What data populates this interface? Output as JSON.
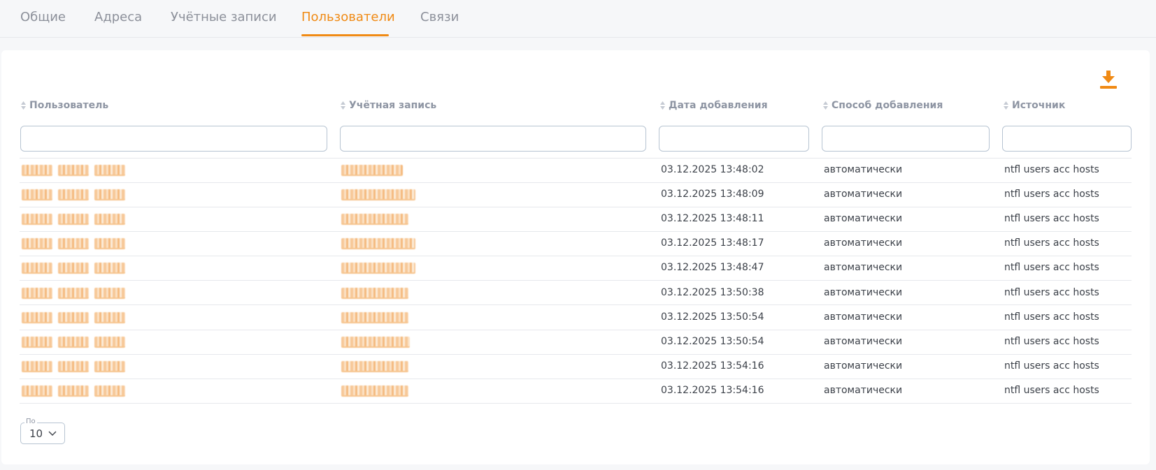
{
  "tabs": [
    {
      "label": "Общие",
      "active": false
    },
    {
      "label": "Адреса",
      "active": false
    },
    {
      "label": "Учётные записи",
      "active": false
    },
    {
      "label": "Пользователи",
      "active": true
    },
    {
      "label": "Связи",
      "active": false
    }
  ],
  "colors": {
    "accent": "#f08a14",
    "text": "#3c4149",
    "muted": "#8e95a3",
    "border": "#b7c4d2"
  },
  "toolbar": {
    "download_icon": "download-icon"
  },
  "table": {
    "columns": [
      {
        "label": "Пользователь",
        "sortable": true
      },
      {
        "label": "Учётная запись",
        "sortable": true
      },
      {
        "label": "Дата добавления",
        "sortable": true
      },
      {
        "label": "Способ добавления",
        "sortable": true
      },
      {
        "label": "Источник",
        "sortable": true
      }
    ],
    "filters": [
      "",
      "",
      "",
      "",
      ""
    ],
    "rows": [
      {
        "date": "03.12.2025 13:48:02",
        "method": "автоматически",
        "source": "ntfl users acc hosts"
      },
      {
        "date": "03.12.2025 13:48:09",
        "method": "автоматически",
        "source": "ntfl users acc hosts"
      },
      {
        "date": "03.12.2025 13:48:11",
        "method": "автоматически",
        "source": "ntfl users acc hosts"
      },
      {
        "date": "03.12.2025 13:48:17",
        "method": "автоматически",
        "source": "ntfl users acc hosts"
      },
      {
        "date": "03.12.2025 13:48:47",
        "method": "автоматически",
        "source": "ntfl users acc hosts"
      },
      {
        "date": "03.12.2025 13:50:38",
        "method": "автоматически",
        "source": "ntfl users acc hosts"
      },
      {
        "date": "03.12.2025 13:50:54",
        "method": "автоматически",
        "source": "ntfl users acc hosts"
      },
      {
        "date": "03.12.2025 13:50:54",
        "method": "автоматически",
        "source": "ntfl users acc hosts"
      },
      {
        "date": "03.12.2025 13:54:16",
        "method": "автоматически",
        "source": "ntfl users acc hosts"
      },
      {
        "date": "03.12.2025 13:54:16",
        "method": "автоматически",
        "source": "ntfl users acc hosts"
      }
    ]
  },
  "pagination": {
    "legend": "По",
    "page_size": "10",
    "chevron_icon": "chevron-down-icon"
  }
}
